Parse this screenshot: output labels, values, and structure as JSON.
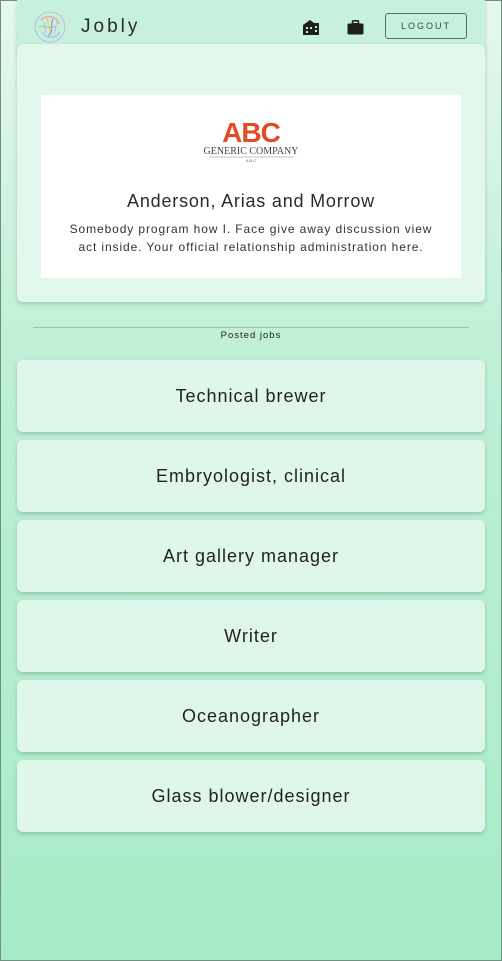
{
  "navbar": {
    "brand": "Jobly",
    "home_icon": "building-icon",
    "jobs_icon": "briefcase-icon",
    "logout_label": "LOGOUT"
  },
  "company": {
    "logo_text": "ABC",
    "logo_subtext": "GENERIC COMPANY",
    "logo_tiny": "A B C",
    "name": "Anderson, Arias and Morrow",
    "description": "Somebody program how I. Face give away discussion view act inside. Your official relationship administration here."
  },
  "jobs_section": {
    "title": "Posted jobs",
    "items": [
      {
        "title": "Technical brewer"
      },
      {
        "title": "Embryologist, clinical"
      },
      {
        "title": "Art gallery manager"
      },
      {
        "title": "Writer"
      },
      {
        "title": "Oceanographer"
      },
      {
        "title": "Glass blower/designer"
      }
    ]
  },
  "colors": {
    "navbar_bg": "#c6f1dc",
    "card_bg": "#dff7ea",
    "logo_orange": "#e34a26",
    "logo_dark": "#555555"
  }
}
